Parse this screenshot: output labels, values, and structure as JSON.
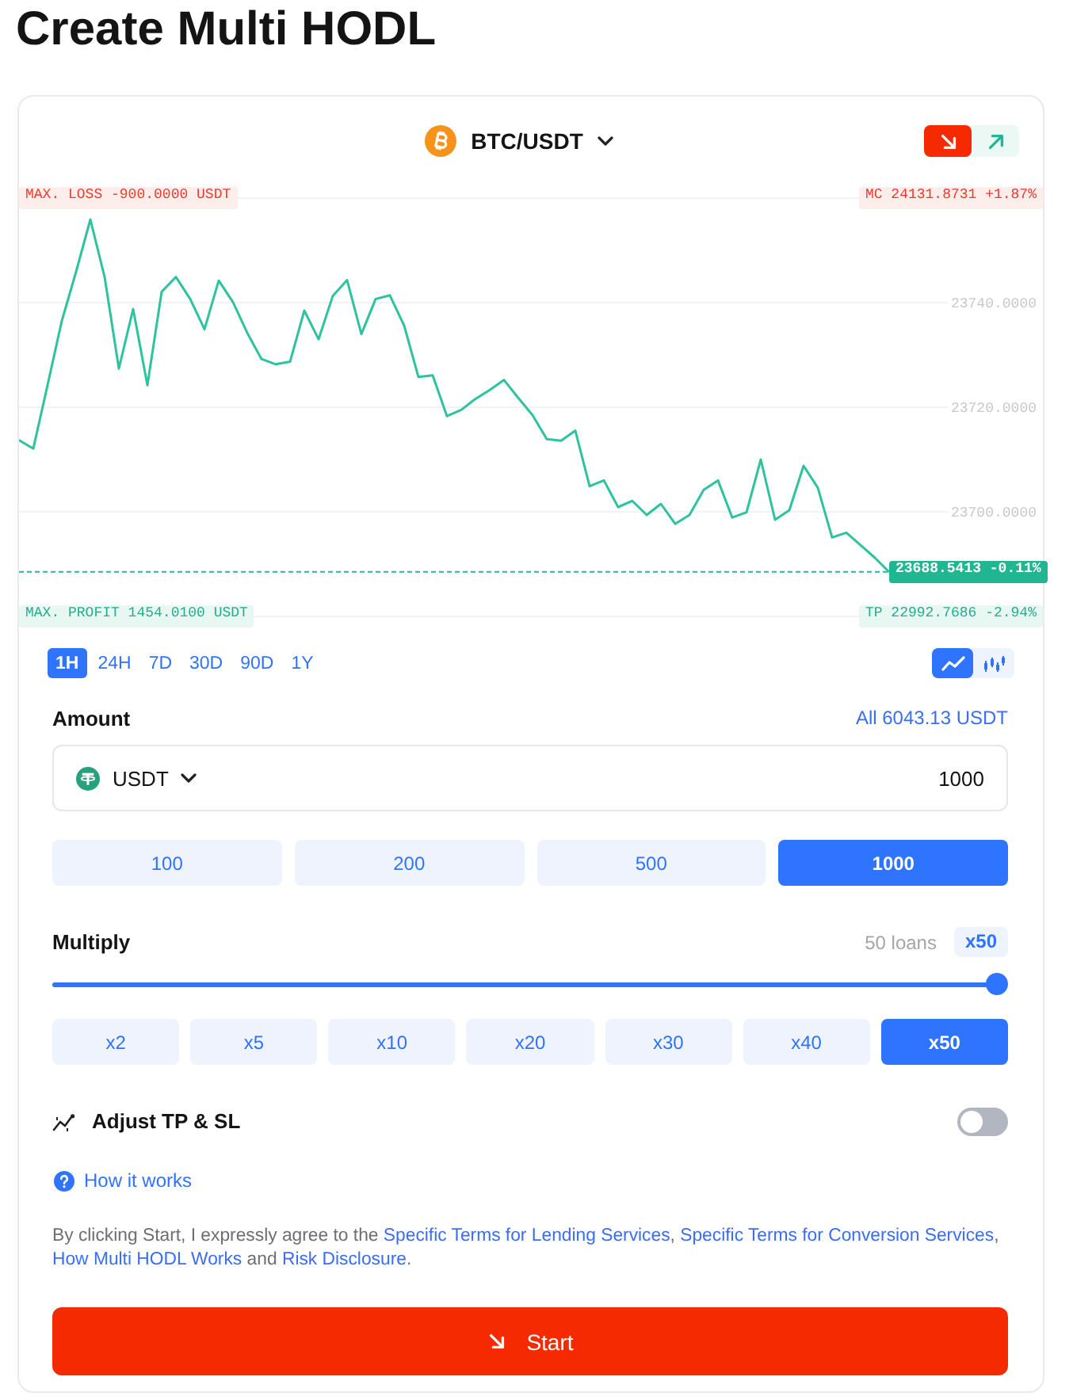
{
  "page": {
    "title": "Create Multi HODL"
  },
  "pair": {
    "label": "BTC/USDT"
  },
  "direction_buttons": [
    {
      "kind": "down",
      "selected": true
    },
    {
      "kind": "up",
      "selected": false
    }
  ],
  "chart": {
    "max_loss": "MAX. LOSS -900.0000 USDT",
    "margin_call": "MC 24131.8731 +1.87%",
    "max_profit": "MAX. PROFIT 1454.0100 USDT",
    "take_profit": "TP 22992.7686 -2.94%",
    "chart_data": {
      "type": "line",
      "grid": true,
      "ylim": [
        23680,
        23760
      ],
      "yticks": [
        {
          "value": 23700,
          "label": "23700.0000"
        },
        {
          "value": 23720,
          "label": "23720.0000"
        },
        {
          "value": 23740,
          "label": "23740.0000"
        }
      ],
      "ref_lines": [
        {
          "axis": "y",
          "value": 23688.5413,
          "label": "23688.5413 -0.11%"
        }
      ],
      "values": [
        23713.7,
        23712.1,
        23724.2,
        23736.5,
        23745.9,
        23755.9,
        23744.9,
        23727.4,
        23738.8,
        23724.2,
        23742.1,
        23744.9,
        23740.7,
        23734.9,
        23744.2,
        23740.1,
        23734.2,
        23729.2,
        23728.2,
        23728.7,
        23738.5,
        23733.0,
        23741.3,
        23744.3,
        23734.0,
        23740.7,
        23741.4,
        23735.6,
        23725.8,
        23726.1,
        23718.3,
        23719.5,
        23721.6,
        23723.3,
        23725.2,
        23721.8,
        23718.5,
        23713.9,
        23713.6,
        23715.5,
        23704.9,
        23706.0,
        23700.9,
        23702.1,
        23699.4,
        23701.5,
        23697.7,
        23699.4,
        23704.2,
        23706.0,
        23698.9,
        23699.9,
        23710.0,
        23698.5,
        23700.3,
        23708.8,
        23704.6,
        23695.1,
        23696.0,
        23693.6,
        23691.2,
        23688.5
      ]
    }
  },
  "time_ranges": [
    {
      "label": "1H",
      "selected": true
    },
    {
      "label": "24H",
      "selected": false
    },
    {
      "label": "7D",
      "selected": false
    },
    {
      "label": "30D",
      "selected": false
    },
    {
      "label": "90D",
      "selected": false
    },
    {
      "label": "1Y",
      "selected": false
    }
  ],
  "chart_types": [
    {
      "kind": "line",
      "selected": true
    },
    {
      "kind": "candles",
      "selected": false
    }
  ],
  "amount": {
    "label": "Amount",
    "available": "All 6043.13 USDT",
    "currency": "USDT",
    "value": "1000",
    "presets": [
      {
        "label": "100",
        "selected": false
      },
      {
        "label": "200",
        "selected": false
      },
      {
        "label": "500",
        "selected": false
      },
      {
        "label": "1000",
        "selected": true
      }
    ]
  },
  "multiply": {
    "label": "Multiply",
    "loans": "50 loans",
    "value": "x50",
    "level": 1,
    "options": [
      {
        "label": "x2",
        "selected": false
      },
      {
        "label": "x5",
        "selected": false
      },
      {
        "label": "x10",
        "selected": false
      },
      {
        "label": "x20",
        "selected": false
      },
      {
        "label": "x30",
        "selected": false
      },
      {
        "label": "x40",
        "selected": false
      },
      {
        "label": "x50",
        "selected": true
      }
    ]
  },
  "adjust_tp_sl": {
    "label": "Adjust TP & SL",
    "on": false
  },
  "help_link": {
    "label": "How it works"
  },
  "terms": [
    {
      "kind": "text",
      "text": "By clicking Start, I expressly agree to the "
    },
    {
      "kind": "link",
      "text": "Specific Terms for Lending Services"
    },
    {
      "kind": "text",
      "text": ", "
    },
    {
      "kind": "link",
      "text": "Specific Terms for Conversion Services"
    },
    {
      "kind": "text",
      "text": ", "
    },
    {
      "kind": "link",
      "text": "How Multi HODL Works"
    },
    {
      "kind": "text",
      "text": " and "
    },
    {
      "kind": "link",
      "text": "Risk Disclosure"
    },
    {
      "kind": "text",
      "text": "."
    }
  ],
  "start_button": {
    "label": "Start"
  }
}
